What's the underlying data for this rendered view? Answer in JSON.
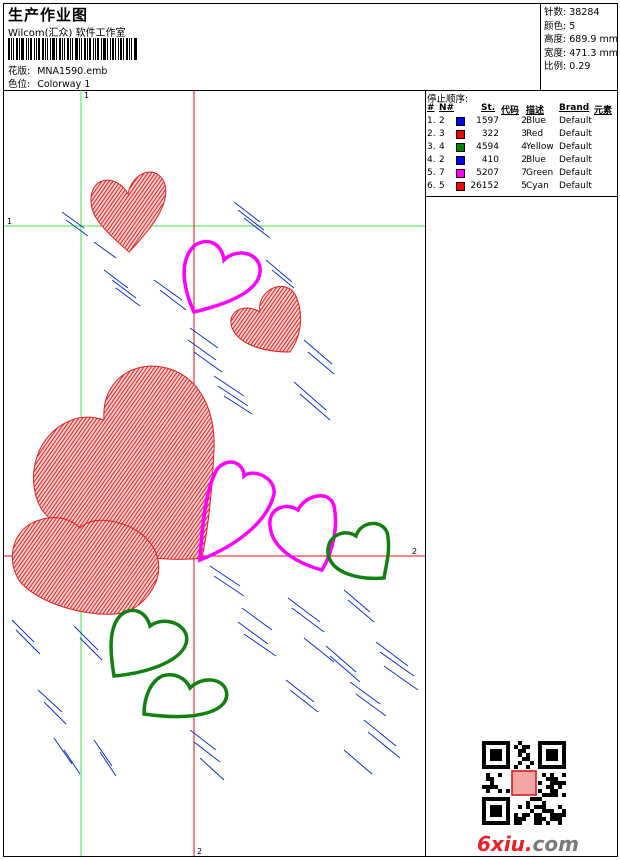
{
  "header": {
    "title": "生产作业图",
    "company": "Wilcom(汇众) 软件工作室",
    "design_label": "花版:",
    "design_value": "MNA1590.emb",
    "colorway_label": "色位:",
    "colorway_value": "Colorway 1"
  },
  "stats": [
    {
      "label": "针数:",
      "value": "38284"
    },
    {
      "label": "颜色:",
      "value": "5"
    },
    {
      "label": "高度:",
      "value": "689.9 mm"
    },
    {
      "label": "宽度:",
      "value": "471.3 mm"
    },
    {
      "label": "比例:",
      "value": "0.29"
    }
  ],
  "canvas": {
    "guide_labels": {
      "v_green": "1",
      "h_green": "1",
      "v_red": "2",
      "h_red": "2"
    },
    "colors": {
      "red": "#e02020",
      "magenta": "#ff00ff",
      "green": "#108010",
      "blue": "#1030d0",
      "guide_green": "#40e040",
      "guide_red": "#e01010"
    }
  },
  "stop_sequence": {
    "title": "停止顺序:",
    "columns": [
      "#",
      "N#",
      "St.",
      "代码",
      "描述",
      "Brand",
      "元素"
    ],
    "rows": [
      {
        "num": "1.",
        "n": "2",
        "color": "#0000ff",
        "st": "1597",
        "code": "2",
        "desc": "Blue",
        "brand": "Default"
      },
      {
        "num": "2.",
        "n": "3",
        "color": "#ff0000",
        "st": "322",
        "code": "3",
        "desc": "Red",
        "brand": "Default"
      },
      {
        "num": "3.",
        "n": "4",
        "color": "#008000",
        "st": "4594",
        "code": "4",
        "desc": "Yellow",
        "brand": "Default"
      },
      {
        "num": "4.",
        "n": "2",
        "color": "#0000ff",
        "st": "410",
        "code": "2",
        "desc": "Blue",
        "brand": "Default"
      },
      {
        "num": "5.",
        "n": "7",
        "color": "#ff00ff",
        "st": "5207",
        "code": "7",
        "desc": "Green",
        "brand": "Default"
      },
      {
        "num": "6.",
        "n": "5",
        "color": "#ff0000",
        "st": "26152",
        "code": "5",
        "desc": "Cyan",
        "brand": "Default"
      }
    ]
  },
  "watermark": {
    "brand": "6xiu",
    "dot": ".",
    "tld": "com"
  }
}
